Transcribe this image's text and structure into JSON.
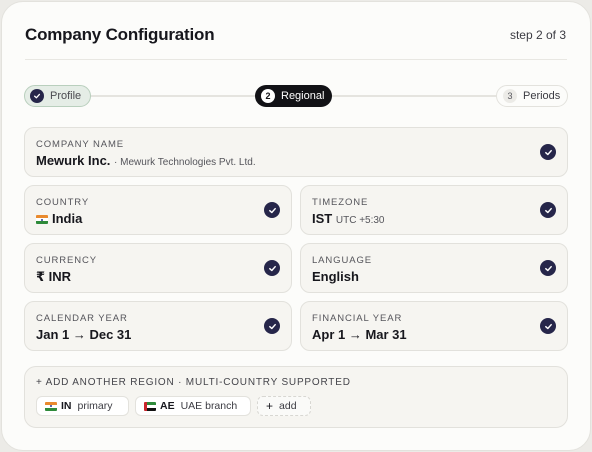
{
  "header": {
    "title": "Company Configuration",
    "step": "step 2 of 3"
  },
  "stepper": {
    "steps": [
      {
        "num": "",
        "label": "Profile",
        "state": "done"
      },
      {
        "num": "2",
        "label": "Regional",
        "state": "active"
      },
      {
        "num": "3",
        "label": "Periods",
        "state": "todo"
      }
    ]
  },
  "fields": {
    "company": {
      "label": "Company name",
      "value": "Mewurk Inc.",
      "sub": "· Mewurk Technologies Pvt. Ltd."
    },
    "country": {
      "label": "Country",
      "value": "India"
    },
    "timezone": {
      "label": "Timezone",
      "value": "IST",
      "sub": "UTC +5:30"
    },
    "currency": {
      "label": "Currency",
      "value": "₹ INR"
    },
    "language": {
      "label": "Language",
      "value": "English"
    },
    "calendar": {
      "label": "Calendar year",
      "value": "Jan 1 → Dec 31"
    },
    "financial": {
      "label": "Financial year",
      "value": "Apr 1 → Mar 31"
    }
  },
  "regions": {
    "heading": "+ Add another region · multi-country supported",
    "chips": [
      {
        "code": "IN",
        "text": "primary"
      },
      {
        "code": "AE",
        "text": "UAE branch"
      }
    ],
    "add_label": "add"
  },
  "colors": {
    "accent": "#26264a",
    "active_pill": "#121216",
    "done_pill": "#e5ede6"
  }
}
